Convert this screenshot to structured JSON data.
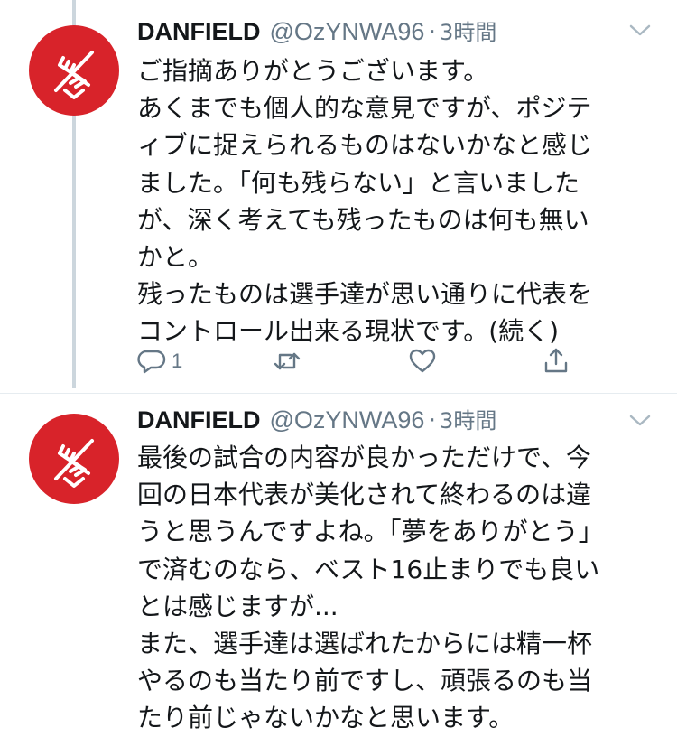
{
  "tweets": [
    {
      "name": "DANFIELD",
      "handle": "@OzYNWA96",
      "separator": "·",
      "time": "3時間",
      "lines": [
        "ご指摘ありがとうございます。",
        "あくまでも個人的な意見ですが、ポジテ",
        "ィブに捉えられるものはないかなと感じ",
        "ました。「何も残らない」と言いました",
        "が、深く考えても残ったものは何も無い",
        "かと。",
        "残ったものは選手達が思い通りに代表を",
        "コントロール出来る現状です。(続く)"
      ],
      "reply_count": "1"
    },
    {
      "name": "DANFIELD",
      "handle": "@OzYNWA96",
      "separator": "·",
      "time": "3時間",
      "lines": [
        "最後の試合の内容が良かっただけで、今",
        "回の日本代表が美化されて終わるのは違",
        "うと思うんですよね。「夢をありがとう」",
        "で済むのなら、ベスト16止まりでも良い",
        "とは感じますが...",
        "また、選手達は選ばれたからには精一杯",
        "やるのも当たり前ですし、頑張るのも当",
        "たり前じゃないかなと思います。"
      ]
    }
  ],
  "icons": {
    "avatar": "danfield-logo",
    "menu": "chevron-down-icon",
    "reply": "reply-icon",
    "retweet": "retweet-icon",
    "like": "heart-icon",
    "share": "share-icon"
  },
  "colors": {
    "avatar_bg": "#d8232a",
    "text": "#14171a",
    "secondary": "#657786",
    "thread_line": "#ccd6dd"
  }
}
